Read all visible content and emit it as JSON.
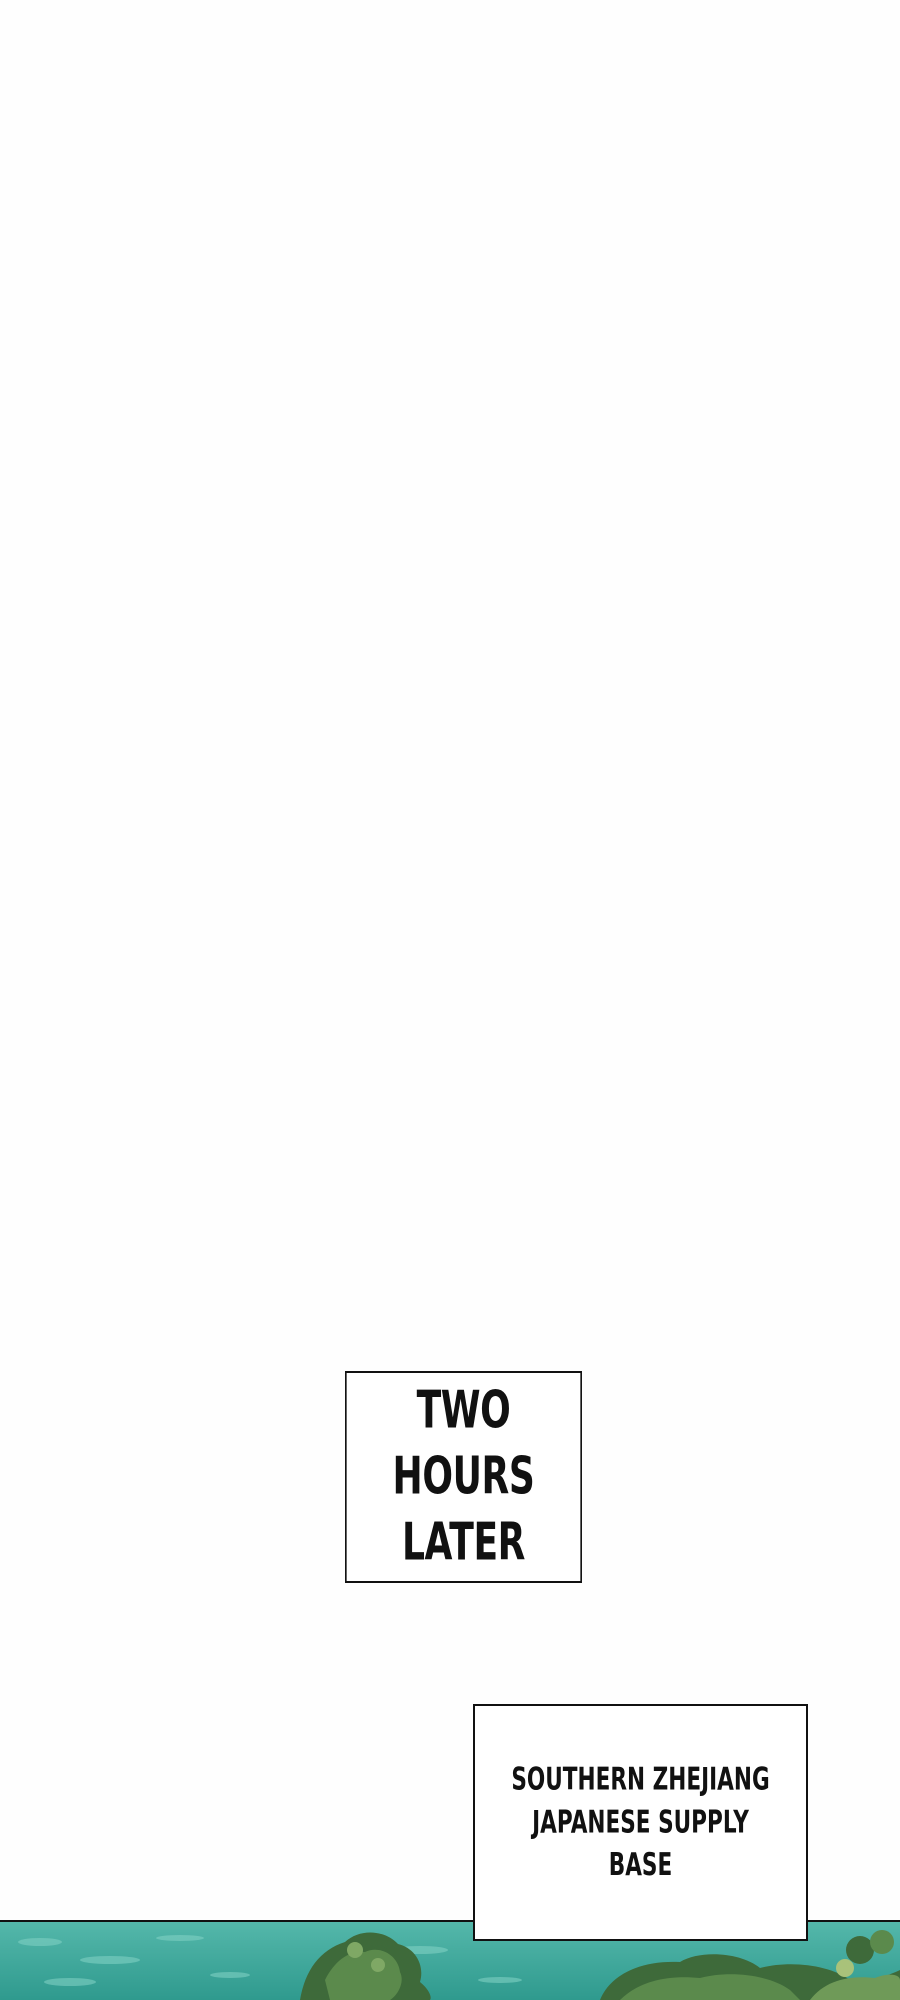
{
  "panel": {
    "time_caption": "TWO HOURS\nLATER",
    "location_caption": "SOUTHERN ZHEJIANG\nJAPANESE SUPPLY BASE"
  },
  "scene": {
    "description_icon": "water-and-trees-illustration",
    "colors": {
      "water": "#3fa89c",
      "water_light": "#6cc6b9",
      "foliage_dark": "#3e6a3a",
      "foliage_mid": "#5b8a4c",
      "foliage_light": "#7fa865",
      "border": "#111111"
    }
  }
}
